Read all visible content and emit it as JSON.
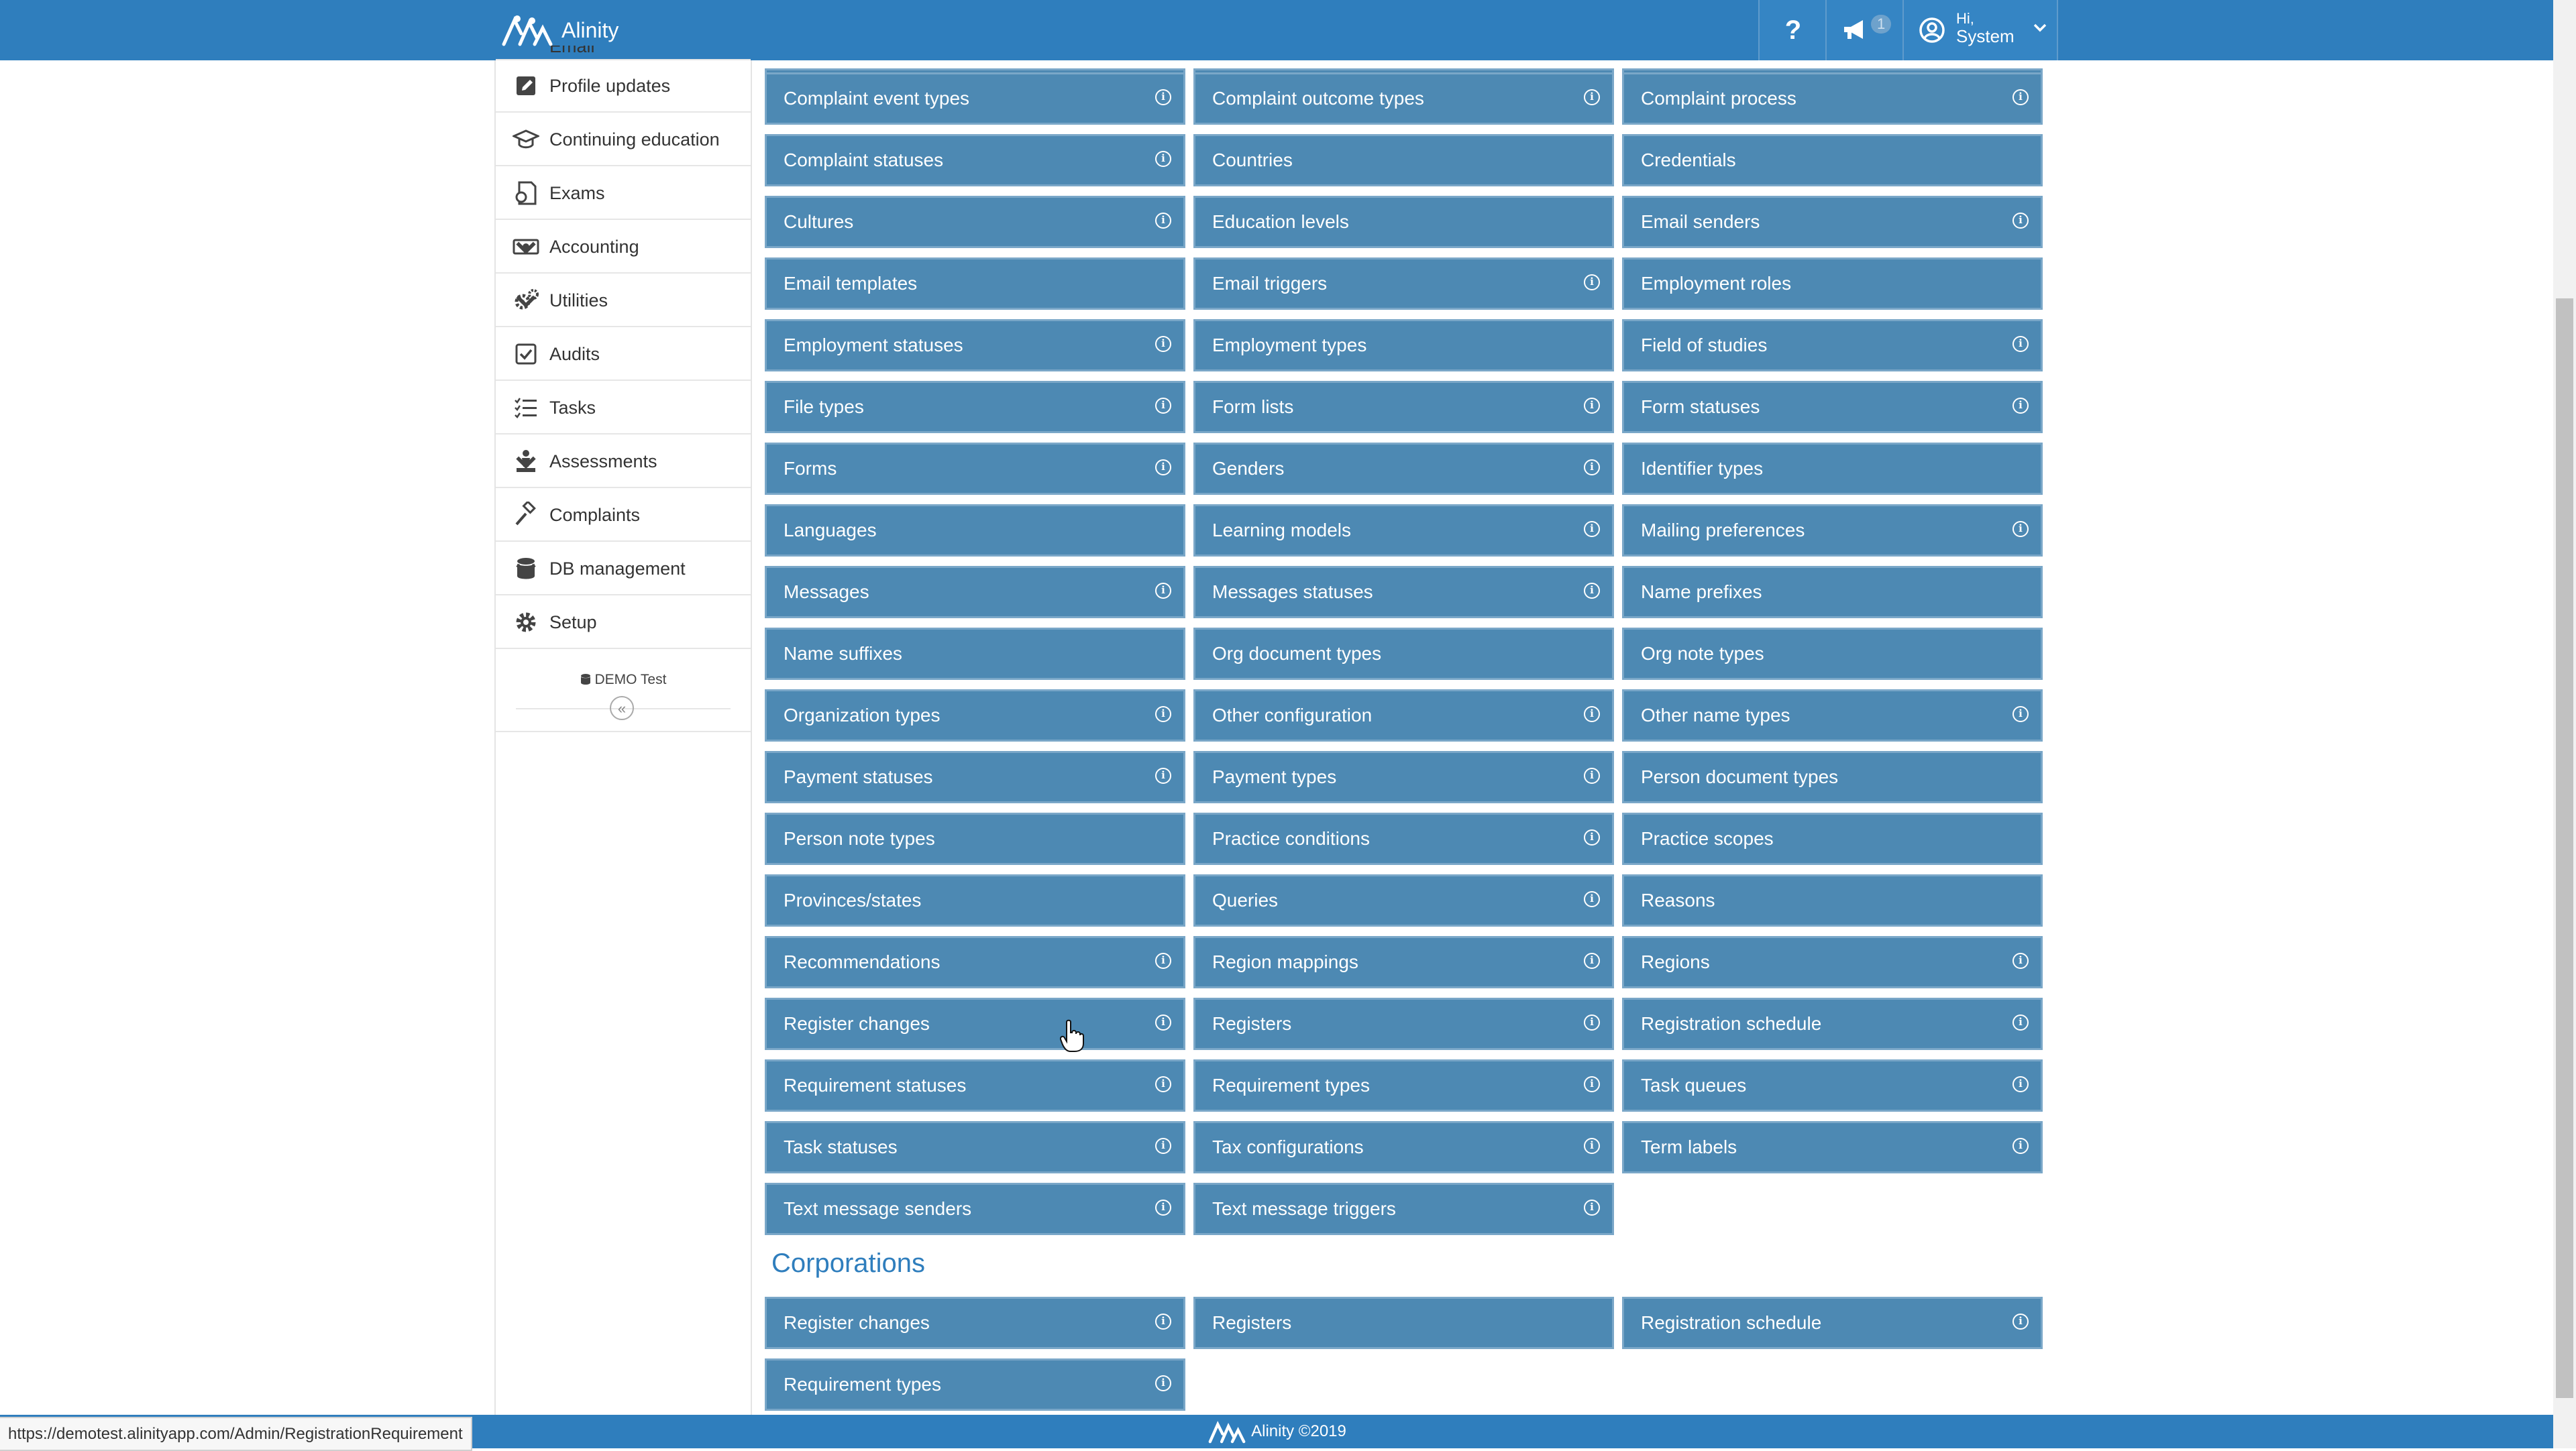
{
  "app": {
    "name": "Alinity"
  },
  "topbar": {
    "help_label": "?",
    "notification_count": "1",
    "user_greeting": "Hi,",
    "user_name": "System"
  },
  "sidebar": {
    "items": [
      {
        "label": "Email",
        "icon": "email-icon"
      },
      {
        "label": "Profile updates",
        "icon": "edit-icon"
      },
      {
        "label": "Continuing education",
        "icon": "graduation-cap-icon"
      },
      {
        "label": "Exams",
        "icon": "exam-icon"
      },
      {
        "label": "Accounting",
        "icon": "money-icon"
      },
      {
        "label": "Utilities",
        "icon": "gears-icon"
      },
      {
        "label": "Audits",
        "icon": "checkbox-icon"
      },
      {
        "label": "Tasks",
        "icon": "task-list-icon"
      },
      {
        "label": "Assessments",
        "icon": "assessment-icon"
      },
      {
        "label": "Complaints",
        "icon": "gavel-icon"
      },
      {
        "label": "DB management",
        "icon": "database-icon"
      },
      {
        "label": "Setup",
        "icon": "gear-icon"
      }
    ],
    "environment": "DEMO Test",
    "collapse_symbol": "«"
  },
  "main": {
    "tiles": [
      {
        "label": "Complaint event types",
        "info": true
      },
      {
        "label": "Complaint outcome types",
        "info": true
      },
      {
        "label": "Complaint process",
        "info": true
      },
      {
        "label": "Complaint statuses",
        "info": true
      },
      {
        "label": "Countries",
        "info": false
      },
      {
        "label": "Credentials",
        "info": false
      },
      {
        "label": "Cultures",
        "info": true
      },
      {
        "label": "Education levels",
        "info": false
      },
      {
        "label": "Email senders",
        "info": true
      },
      {
        "label": "Email templates",
        "info": false
      },
      {
        "label": "Email triggers",
        "info": true
      },
      {
        "label": "Employment roles",
        "info": false
      },
      {
        "label": "Employment statuses",
        "info": true
      },
      {
        "label": "Employment types",
        "info": false
      },
      {
        "label": "Field of studies",
        "info": true
      },
      {
        "label": "File types",
        "info": true
      },
      {
        "label": "Form lists",
        "info": true
      },
      {
        "label": "Form statuses",
        "info": true
      },
      {
        "label": "Forms",
        "info": true
      },
      {
        "label": "Genders",
        "info": true
      },
      {
        "label": "Identifier types",
        "info": false
      },
      {
        "label": "Languages",
        "info": false
      },
      {
        "label": "Learning models",
        "info": true
      },
      {
        "label": "Mailing preferences",
        "info": true
      },
      {
        "label": "Messages",
        "info": true
      },
      {
        "label": "Messages statuses",
        "info": true
      },
      {
        "label": "Name prefixes",
        "info": false
      },
      {
        "label": "Name suffixes",
        "info": false
      },
      {
        "label": "Org document types",
        "info": false
      },
      {
        "label": "Org note types",
        "info": false
      },
      {
        "label": "Organization types",
        "info": true
      },
      {
        "label": "Other configuration",
        "info": true
      },
      {
        "label": "Other name types",
        "info": true
      },
      {
        "label": "Payment statuses",
        "info": true
      },
      {
        "label": "Payment types",
        "info": true
      },
      {
        "label": "Person document types",
        "info": false
      },
      {
        "label": "Person note types",
        "info": false
      },
      {
        "label": "Practice conditions",
        "info": true
      },
      {
        "label": "Practice scopes",
        "info": false
      },
      {
        "label": "Provinces/states",
        "info": false
      },
      {
        "label": "Queries",
        "info": true
      },
      {
        "label": "Reasons",
        "info": false
      },
      {
        "label": "Recommendations",
        "info": true
      },
      {
        "label": "Region mappings",
        "info": true
      },
      {
        "label": "Regions",
        "info": true
      },
      {
        "label": "Register changes",
        "info": true
      },
      {
        "label": "Registers",
        "info": true
      },
      {
        "label": "Registration schedule",
        "info": true
      },
      {
        "label": "Requirement statuses",
        "info": true
      },
      {
        "label": "Requirement types",
        "info": true
      },
      {
        "label": "Task queues",
        "info": true
      },
      {
        "label": "Task statuses",
        "info": true
      },
      {
        "label": "Tax configurations",
        "info": true
      },
      {
        "label": "Term labels",
        "info": true
      },
      {
        "label": "Text message senders",
        "info": true
      },
      {
        "label": "Text message triggers",
        "info": true
      }
    ],
    "corporations_title": "Corporations",
    "corporation_tiles": [
      {
        "label": "Register changes",
        "info": true
      },
      {
        "label": "Registers",
        "info": false
      },
      {
        "label": "Registration schedule",
        "info": true
      },
      {
        "label": "Requirement types",
        "info": true
      }
    ],
    "info_symbol": "i"
  },
  "footer": {
    "text": "Alinity ©2019"
  },
  "status_bar": {
    "url": "https://demotest.alinityapp.com/Admin/RegistrationRequirement"
  },
  "colors": {
    "topbar": "#2f7ebd",
    "tile": "#4d89b3",
    "section_title": "#2f7ebd"
  }
}
